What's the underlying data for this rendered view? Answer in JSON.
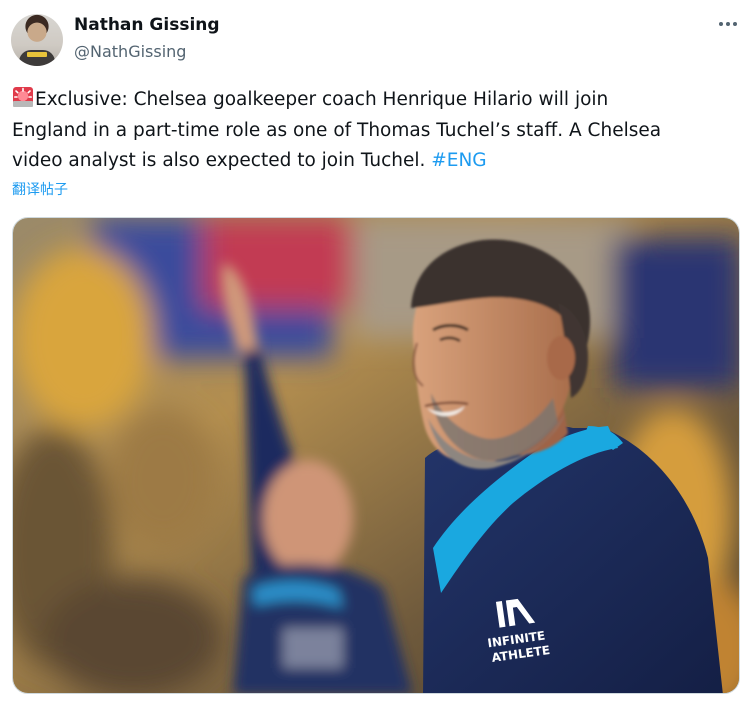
{
  "author": {
    "display_name": "Nathan Gissing",
    "handle": "@NathGissing"
  },
  "tweet": {
    "emoji_icon": "police-siren-icon",
    "lines": [
      "Exclusive: Chelsea goalkeeper coach Henrique Hilario will join",
      "England in a part-time role as one of Thomas Tuchel’s staff. A Chelsea",
      "video analyst is also expected to join Tuchel. "
    ],
    "hashtag": "#ENG",
    "translate_label": "翻译帖子"
  },
  "media": {
    "kind": "photo",
    "shirt_logo_line1": "INFINITE",
    "shirt_logo_line2": "ATHLETE"
  },
  "colors": {
    "accent": "#1d9bf0",
    "text": "#0f1419",
    "secondary_text": "#536471",
    "border": "#cfd9de",
    "shirt_navy": "#1a2a56",
    "shirt_cyan": "#1aa8e0"
  }
}
